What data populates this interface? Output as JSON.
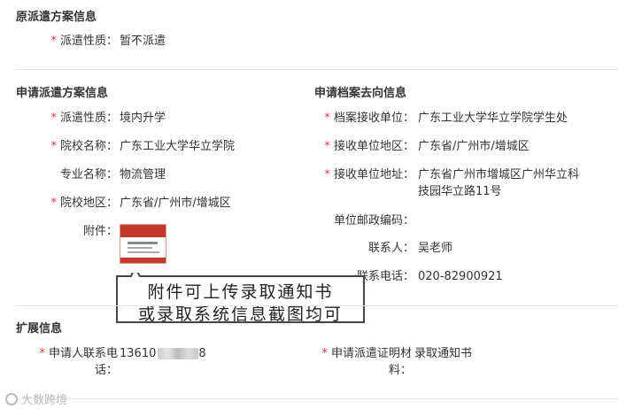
{
  "original": {
    "title": "原派遣方案信息",
    "dispatch_label": "派遣性质：",
    "dispatch_value": "暂不派遣"
  },
  "apply": {
    "title": "申请派遣方案信息",
    "dispatch_label": "派遣性质：",
    "dispatch_value": "境内升学",
    "school_label": "院校名称：",
    "school_value": "广东工业大学华立学院",
    "major_label": "专业名称：",
    "major_value": "物流管理",
    "region_label": "院校地区：",
    "region_value": "广东省/广州市/增城区",
    "attach_label": "附件："
  },
  "archive": {
    "title": "申请档案去向信息",
    "unit_label": "档案接收单位：",
    "unit_value": "广东工业大学华立学院学生处",
    "region_label": "接收单位地区：",
    "region_value": "广东省/广州市/增城区",
    "address_label": "接收单位地址：",
    "address_line1": "广东省广州市增城区广州华立科",
    "address_line2": "技园华立路11号",
    "postcode_label": "单位邮政编码：",
    "postcode_value": "",
    "contact_label": "联系人：",
    "contact_value": "吴老师",
    "phone_label": "联系电话：",
    "phone_value": "020-82900921"
  },
  "callout": {
    "line1": "附件可上传录取通知书",
    "line2": "或录取系统信息截图均可"
  },
  "ext": {
    "title": "扩展信息",
    "phone_label_line1": "申请人联系电",
    "phone_label_line2": "话：",
    "phone_value": "13610",
    "phone_value_tail": "8",
    "proof_label_line1": "申请派遣证明材",
    "proof_label_line2": "料：",
    "proof_value": "录取通知书"
  },
  "required_mark": "*",
  "watermark": "大数跨境",
  "colors": {
    "required": "#e4393c",
    "divider": "#e6e6e6"
  }
}
